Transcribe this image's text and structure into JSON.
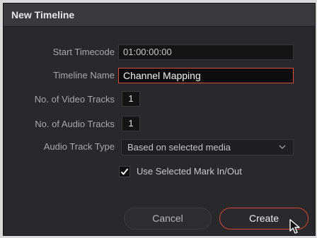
{
  "dialog": {
    "title": "New Timeline"
  },
  "form": {
    "start_timecode_label": "Start Timecode",
    "start_timecode_value": "01:00:00:00",
    "timeline_name_label": "Timeline Name",
    "timeline_name_value": "Channel Mapping",
    "video_tracks_label": "No. of Video Tracks",
    "video_tracks_value": "1",
    "audio_tracks_label": "No. of Audio Tracks",
    "audio_tracks_value": "1",
    "audio_track_type_label": "Audio Track Type",
    "audio_track_type_value": "Based on selected media",
    "use_marks_label": "Use Selected Mark In/Out",
    "use_marks_checked": true
  },
  "buttons": {
    "cancel_label": "Cancel",
    "create_label": "Create"
  },
  "colors": {
    "accent": "#d9503a",
    "dialog_bg": "#29292b"
  },
  "icons": {
    "dropdown": "chevron-down-icon",
    "checkbox": "checkmark-icon",
    "cursor": "mouse-pointer-icon"
  }
}
